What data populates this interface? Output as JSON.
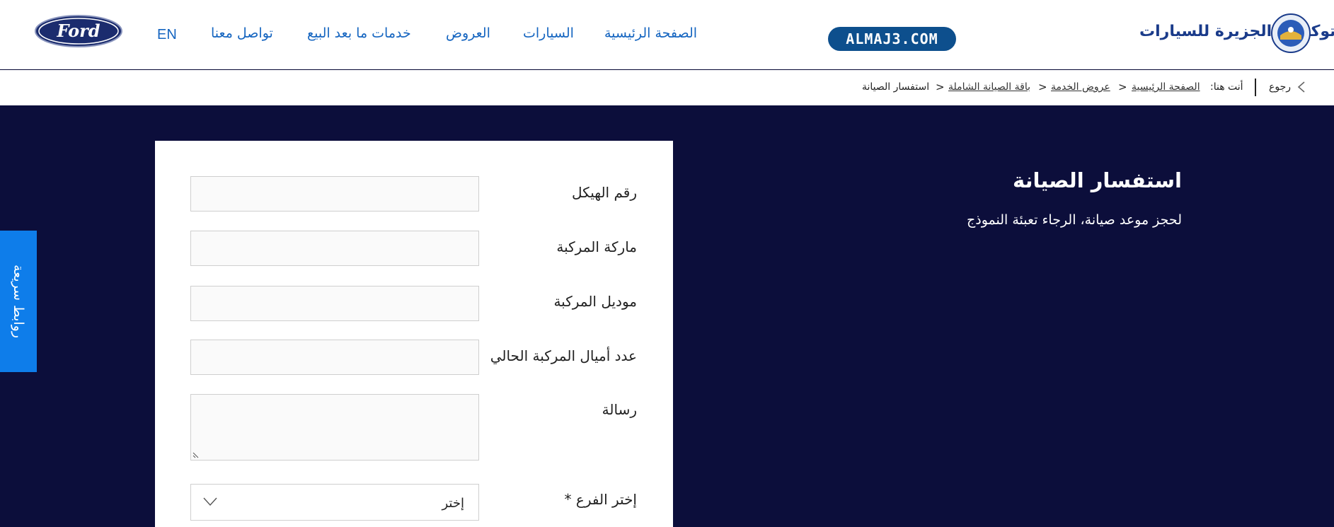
{
  "header": {
    "lang": "EN",
    "nav": [
      "تواصل معنا",
      "خدمات ما بعد البيع",
      "العروض",
      "السيارات",
      "الصفحة الرئيسية"
    ],
    "site_badge": "ALMAJ3.COM",
    "company_name": "شركة توكيلات الجزيرة للسيارات",
    "ford_logo": "Ford"
  },
  "breadcrumb": {
    "back": "رجوع",
    "you_are_here": "أنت هنا:",
    "items": [
      "الصفحة الرئيسية",
      "عروض الخدمة",
      "باقة الصيانة الشاملة",
      "استفسار الصيانة"
    ],
    "separator": ">"
  },
  "quick_links": "روابط سريعة",
  "hero": {
    "title": "استفسار الصيانة",
    "subtitle": "لحجز موعد صيانة، الرجاء تعبئة النموذج"
  },
  "form": {
    "vin_label": "رقم الهيكل",
    "brand_label": "ماركة المركبة",
    "model_label": "موديل المركبة",
    "mileage_label": "عدد أميال المركبة الحالي",
    "message_label": "رسالة",
    "branch_label": "إختر الفرع *",
    "branch_value": "إختر"
  },
  "colors": {
    "accent": "#1565c0",
    "background": "#0c0e3b",
    "quick_tab": "#0e7dea"
  }
}
